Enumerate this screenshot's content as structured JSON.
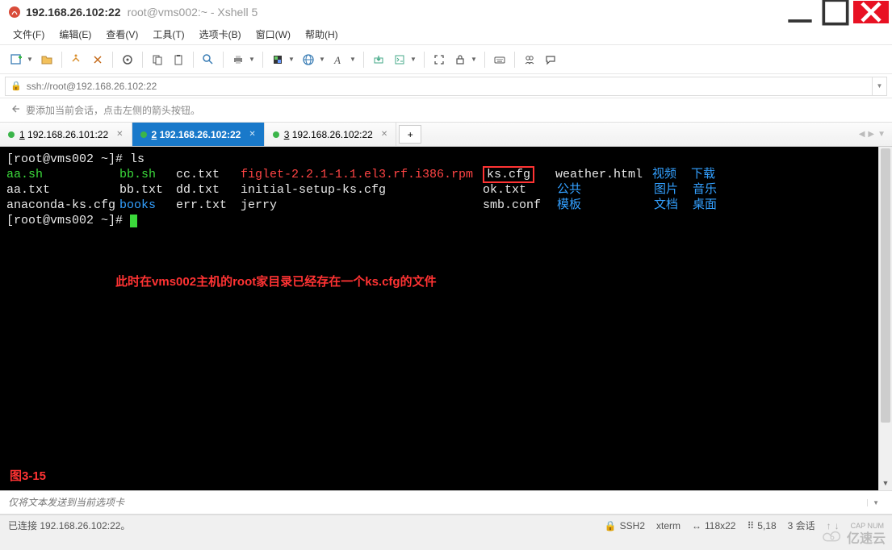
{
  "title": {
    "host": "192.168.26.102:22",
    "session": "root@vms002:~ - Xshell 5"
  },
  "menus": [
    "文件(F)",
    "编辑(E)",
    "查看(V)",
    "工具(T)",
    "选项卡(B)",
    "窗口(W)",
    "帮助(H)"
  ],
  "address": "ssh://root@192.168.26.102:22",
  "hint": "要添加当前会话，点击左侧的箭头按钮。",
  "tabs": [
    {
      "num": "1",
      "label": "192.168.26.101:22",
      "active": false
    },
    {
      "num": "2",
      "label": "192.168.26.102:22",
      "active": true
    },
    {
      "num": "3",
      "label": "192.168.26.102:22",
      "active": false
    }
  ],
  "terminal": {
    "prompt1": "[root@vms002 ~]# ",
    "cmd1": "ls",
    "ls": {
      "row1": [
        "aa.sh",
        "bb.sh",
        "cc.txt",
        "figlet-2.2.1-1.1.el3.rf.i386.rpm",
        "ks.cfg",
        "weather.html",
        "视频",
        "下载"
      ],
      "row2": [
        "aa.txt",
        "bb.txt",
        "dd.txt",
        "initial-setup-ks.cfg",
        "ok.txt",
        "公共",
        "图片",
        "音乐"
      ],
      "row3": [
        "anaconda-ks.cfg",
        "books",
        "err.txt",
        "jerry",
        "smb.conf",
        "模板",
        "文档",
        "桌面"
      ]
    },
    "prompt2": "[root@vms002 ~]# ",
    "annotation": "此时在vms002主机的root家目录已经存在一个ks.cfg的文件",
    "figlabel": "图3-15"
  },
  "send_placeholder": "仅将文本发送到当前选项卡",
  "status": {
    "conn": "已连接 192.168.26.102:22。",
    "proto": "SSH2",
    "term": "xterm",
    "size": "118x22",
    "cursor": "5,18",
    "sessions": "3 会话"
  },
  "watermark": "亿速云"
}
